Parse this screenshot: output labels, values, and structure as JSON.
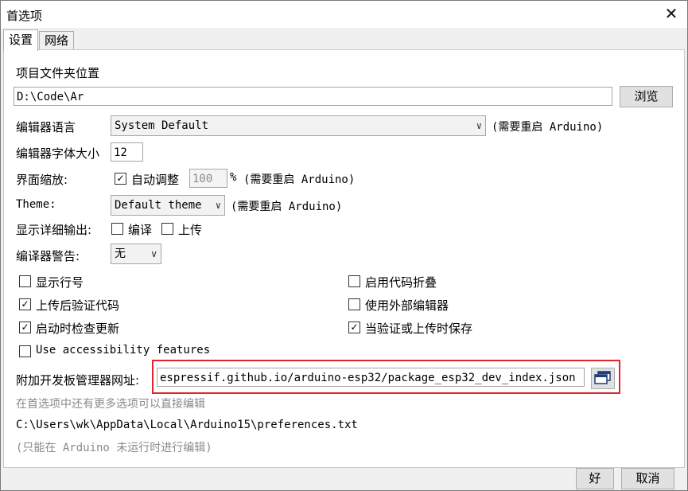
{
  "window": {
    "title": "首选项",
    "close_glyph": "✕"
  },
  "tabs": [
    {
      "label": "设置"
    },
    {
      "label": "网络"
    }
  ],
  "sketchbook": {
    "label": "项目文件夹位置",
    "value": "D:\\Code\\Ar",
    "browse": "浏览"
  },
  "language": {
    "label": "编辑器语言",
    "value": "System Default",
    "note": "(需要重启 Arduino)"
  },
  "font_size": {
    "label": "编辑器字体大小",
    "value": "12"
  },
  "scale": {
    "label": "界面缩放:",
    "auto_label": "自动调整",
    "auto_checked": "✓",
    "value": "100",
    "unit": "%",
    "note": "(需要重启 Arduino)"
  },
  "theme": {
    "label": "Theme:",
    "value": "Default theme",
    "note": "(需要重启 Arduino)"
  },
  "verbose": {
    "label": "显示详细输出:",
    "compile": "编译",
    "upload": "上传"
  },
  "warnings": {
    "label": "编译器警告:",
    "value": "无"
  },
  "options": {
    "line_numbers": {
      "label": "显示行号",
      "mark": ""
    },
    "code_folding": {
      "label": "启用代码折叠",
      "mark": ""
    },
    "verify_upload": {
      "label": "上传后验证代码",
      "mark": "✓"
    },
    "external_editor": {
      "label": "使用外部编辑器",
      "mark": ""
    },
    "check_updates": {
      "label": "启动时检查更新",
      "mark": "✓"
    },
    "save_on_verify": {
      "label": "当验证或上传时保存",
      "mark": "✓"
    },
    "accessibility": {
      "label": "Use accessibility features",
      "mark": ""
    }
  },
  "board_urls": {
    "label": "附加开发板管理器网址:",
    "value": "espressif.github.io/arduino-esp32/package_esp32_dev_index.json"
  },
  "more_options": "在首选项中还有更多选项可以直接编辑",
  "prefs_path": "C:\\Users\\wk\\AppData\\Local\\Arduino15\\preferences.txt",
  "edit_note": "(只能在 Arduino 未运行时进行编辑)",
  "footer": {
    "ok": "好",
    "cancel": "取消"
  },
  "colors": {
    "highlight": "#e0262b",
    "dialog_bg": "#f0f0f0"
  }
}
